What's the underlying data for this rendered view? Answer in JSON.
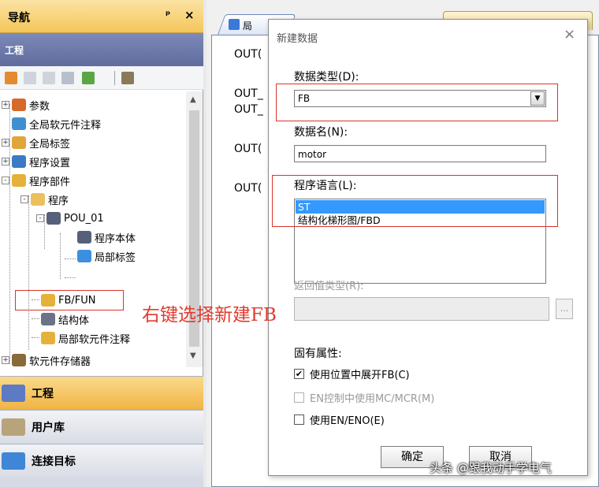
{
  "nav": {
    "title": "导航",
    "pin": "ᵖ",
    "close": "×",
    "project_label": "工程",
    "tree": [
      {
        "label": "参数",
        "expander": "+"
      },
      {
        "label": "全局软元件注释"
      },
      {
        "label": "全局标签",
        "expander": "+"
      },
      {
        "label": "程序设置",
        "expander": "+"
      },
      {
        "label": "程序部件",
        "expander": "-"
      },
      {
        "label": "程序",
        "expander": "-"
      },
      {
        "label": "POU_01",
        "expander": "-"
      },
      {
        "label": "程序本体"
      },
      {
        "label": "局部标签"
      },
      {
        "label": "FB/FUN"
      },
      {
        "label": "结构体"
      },
      {
        "label": "局部软元件注释"
      },
      {
        "label": "软元件存储器",
        "expander": "+"
      }
    ],
    "bottom_buttons": {
      "project": "工程",
      "user_library": "用户库",
      "connection": "连接目标"
    }
  },
  "editor": {
    "tab_label": "局",
    "code_lines": [
      "OUT(",
      "OUT_",
      "OUT_",
      "OUT(",
      "OUT("
    ]
  },
  "dialog": {
    "title": "新建数据",
    "close": "×",
    "data_type_label": "数据类型(D):",
    "data_type_value": "FB",
    "data_name_label": "数据名(N):",
    "data_name_value": "motor",
    "language_label": "程序语言(L):",
    "language_options": [
      "ST",
      "结构化梯形图/FBD"
    ],
    "language_selected": "ST",
    "return_type_label": "返回值类型(R):",
    "return_type_button": "...",
    "props_label": "固有属性:",
    "checks": [
      {
        "label": "使用位置中展开FB(C)",
        "checked": true,
        "enabled": true
      },
      {
        "label": "EN控制中使用MC/MCR(M)",
        "checked": false,
        "enabled": false
      },
      {
        "label": "使用EN/ENO(E)",
        "checked": false,
        "enabled": true
      }
    ],
    "ok_button": "确定",
    "cancel_button": "取消"
  },
  "annotation": "右键选择新建FB",
  "watermark": "头条 @跟我动手学电气",
  "colors": {
    "highlight_red": "#d9342b",
    "selection_blue": "#3399ff",
    "nav_header_gold": "#f4c659",
    "project_bar": "#6b78a8"
  }
}
